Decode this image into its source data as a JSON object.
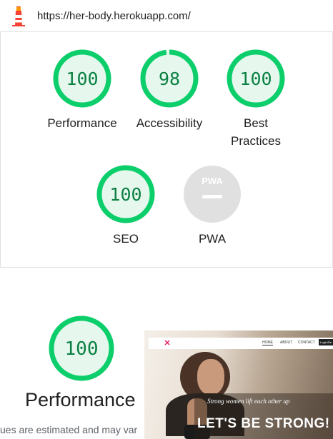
{
  "url_bar": {
    "url": "https://her-body.herokuapp.com/",
    "logo_icon": "lighthouse-icon"
  },
  "colors": {
    "pass_green": "#0cce6b",
    "pass_green_text": "#0b8043",
    "pass_fill": "#e6f8ee",
    "pwa_gray": "#e0e0e0"
  },
  "gauges": [
    {
      "name": "Performance",
      "score": "100",
      "value": 100
    },
    {
      "name": "Accessibility",
      "score": "98",
      "value": 98
    },
    {
      "name": "Best Practices",
      "score": "100",
      "value": 100
    },
    {
      "name": "SEO",
      "score": "100",
      "value": 100
    },
    {
      "name": "PWA",
      "score": "",
      "badge": "PWA",
      "icon": "pwa-badge-icon"
    }
  ],
  "performance_section": {
    "score": "100",
    "value": 100,
    "title": "Performance",
    "note": "ues are estimated and may var"
  },
  "screenshot": {
    "nav": {
      "home": "HOME",
      "about": "ABOUT",
      "contact": "CONTACT",
      "login": "Login/Re"
    },
    "tagline": "Strong women lift each other up",
    "headline": "LET'S BE STRONG!"
  }
}
